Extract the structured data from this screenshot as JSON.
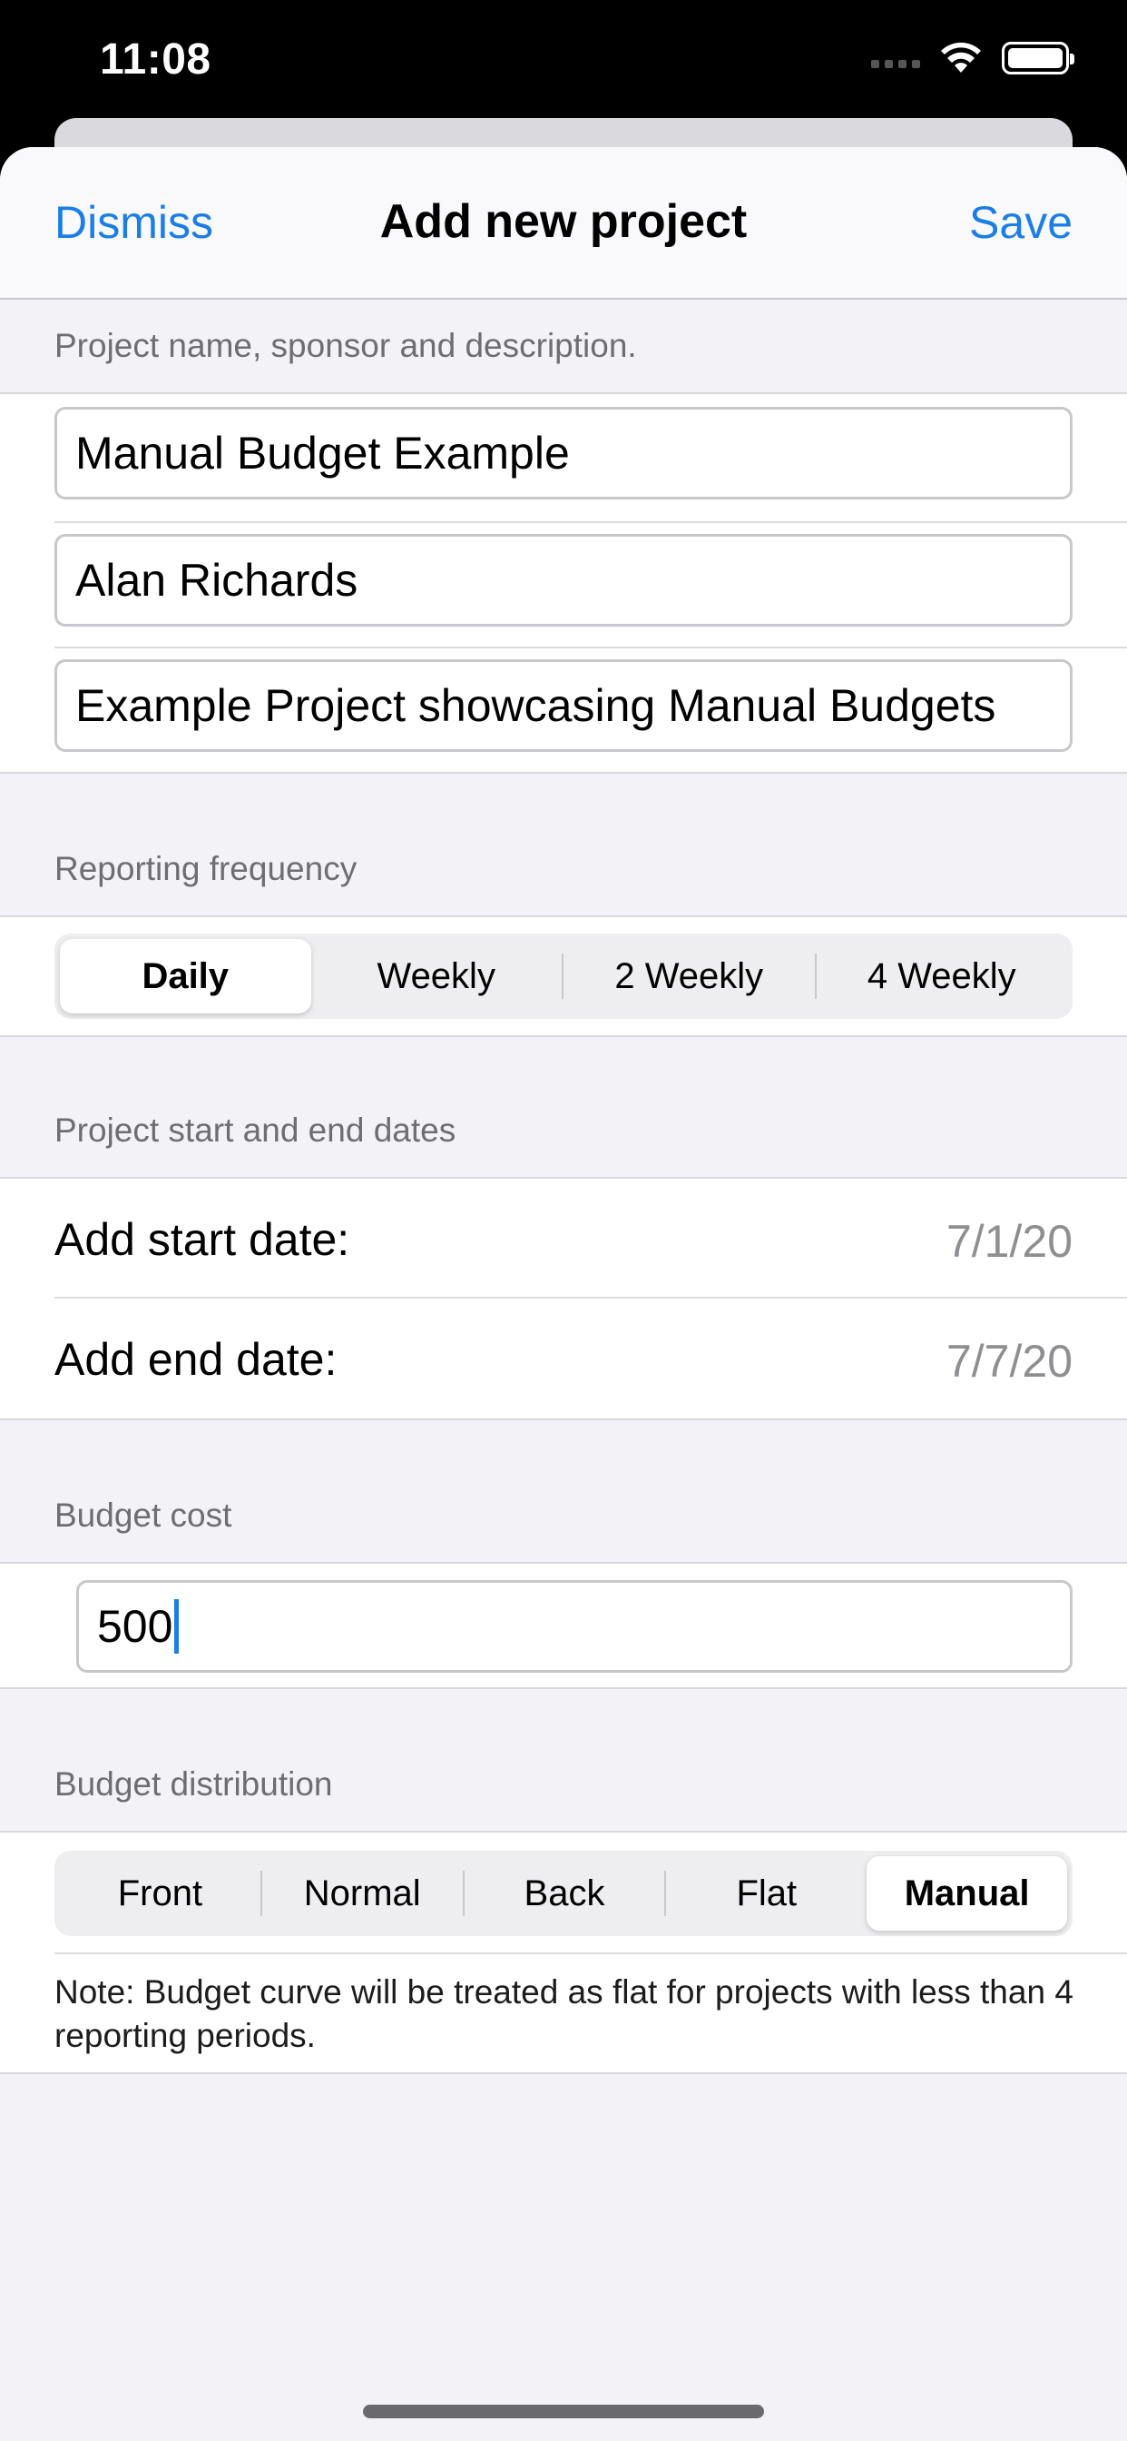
{
  "status_bar": {
    "time": "11:08"
  },
  "nav": {
    "dismiss_label": "Dismiss",
    "title": "Add new project",
    "save_label": "Save"
  },
  "project_section": {
    "header": "Project name, sponsor and description.",
    "name_value": "Manual Budget Example",
    "sponsor_value": "Alan Richards",
    "description_value": "Example Project showcasing Manual Budgets"
  },
  "frequency_section": {
    "header": "Reporting frequency",
    "options": [
      "Daily",
      "Weekly",
      "2 Weekly",
      "4 Weekly"
    ],
    "selected": "Daily"
  },
  "dates_section": {
    "header": "Project start and end dates",
    "start_label": "Add start date:",
    "start_value": "7/1/20",
    "end_label": "Add end date:",
    "end_value": "7/7/20"
  },
  "budget_section": {
    "header": "Budget cost",
    "value": "500"
  },
  "distribution_section": {
    "header": "Budget distribution",
    "options": [
      "Front",
      "Normal",
      "Back",
      "Flat",
      "Manual"
    ],
    "selected": "Manual",
    "note": "Note: Budget curve will be treated as flat for projects with less than 4 reporting periods."
  },
  "colors": {
    "accent": "#1a7ee6",
    "background": "#f2f2f7",
    "secondary_text": "#6d6d72"
  }
}
